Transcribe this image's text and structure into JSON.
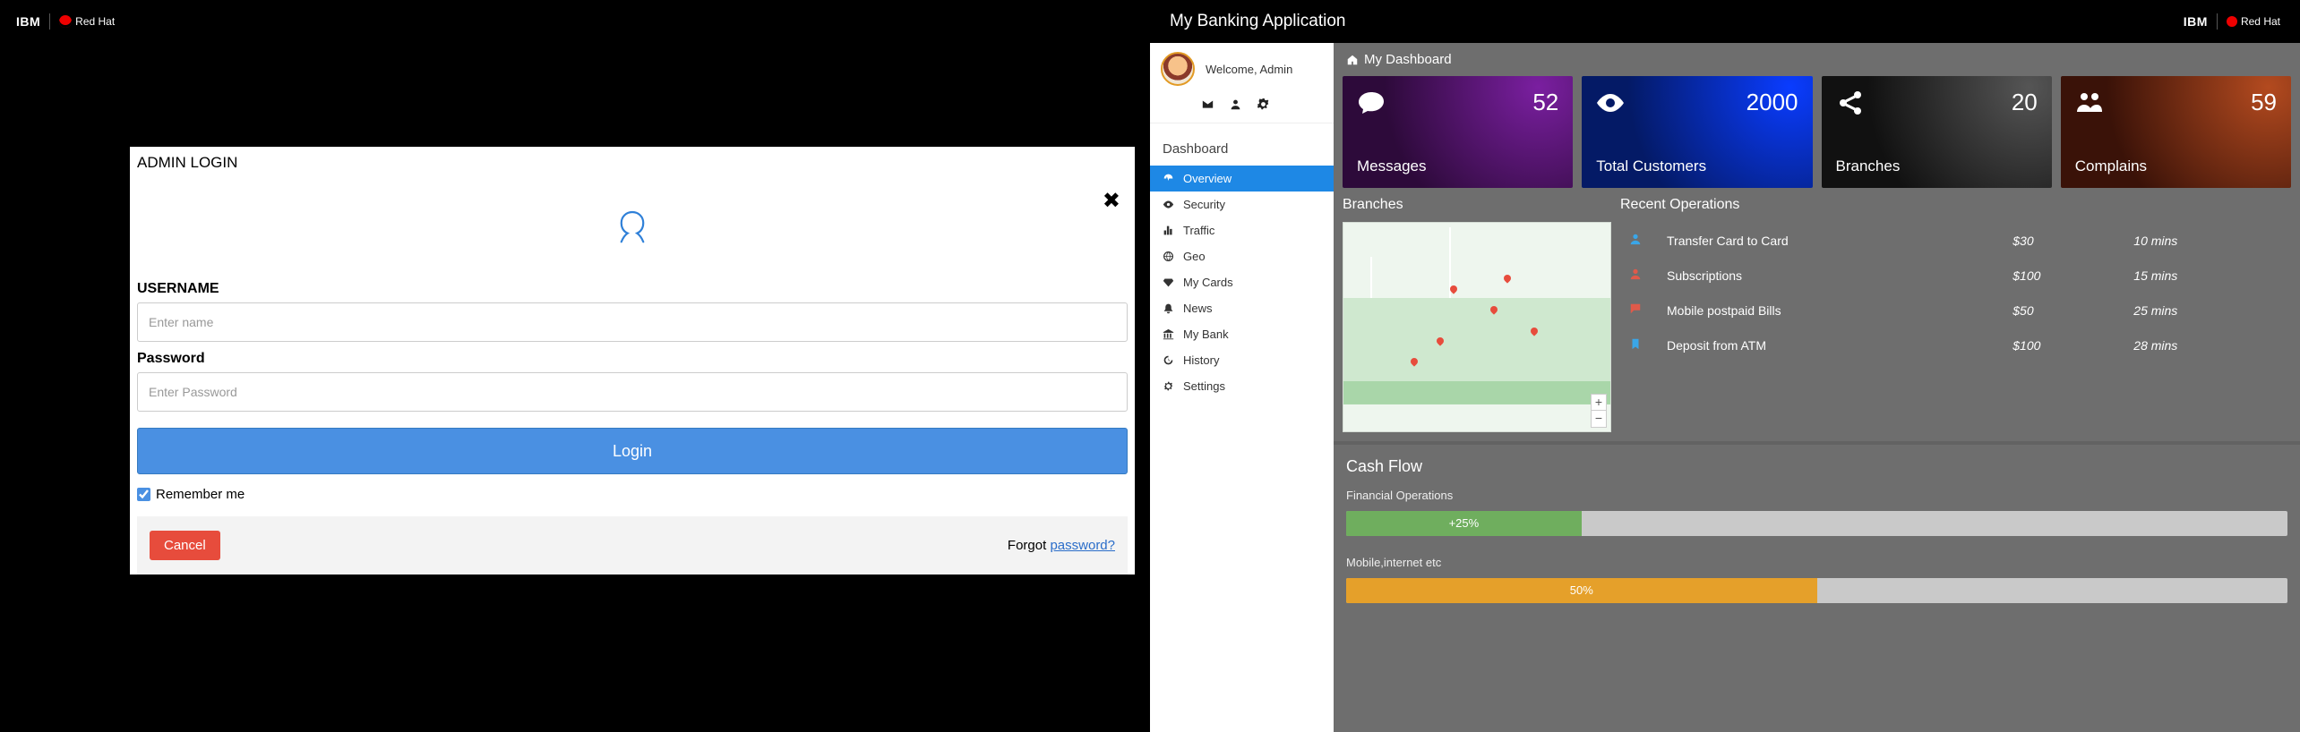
{
  "login": {
    "title": "ADMIN LOGIN",
    "username_label": "USERNAME",
    "username_placeholder": "Enter name",
    "password_label": "Password",
    "password_placeholder": "Enter Password",
    "login_button": "Login",
    "remember_label": "Remember me",
    "cancel_button": "Cancel",
    "forgot_prefix": "Forgot ",
    "forgot_link": "password?"
  },
  "app": {
    "title": "My Banking Application",
    "ibm": "IBM",
    "redhat": "Red Hat"
  },
  "sidebar": {
    "welcome": "Welcome, Admin",
    "heading": "Dashboard",
    "items": [
      {
        "label": "Overview"
      },
      {
        "label": "Security"
      },
      {
        "label": "Traffic"
      },
      {
        "label": "Geo"
      },
      {
        "label": "My Cards"
      },
      {
        "label": "News"
      },
      {
        "label": "My Bank"
      },
      {
        "label": "History"
      },
      {
        "label": "Settings"
      }
    ]
  },
  "crumb": "My Dashboard",
  "stats": [
    {
      "label": "Messages",
      "value": "52"
    },
    {
      "label": "Total Customers",
      "value": "2000"
    },
    {
      "label": "Branches",
      "value": "20"
    },
    {
      "label": "Complains",
      "value": "59"
    }
  ],
  "branches_title": "Branches",
  "ops": {
    "title": "Recent Operations",
    "rows": [
      {
        "name": "Transfer Card to Card",
        "amount": "$30",
        "time": "10 mins",
        "icon": "user",
        "color": "#3aa6e8"
      },
      {
        "name": "Subscriptions",
        "amount": "$100",
        "time": "15 mins",
        "icon": "user",
        "color": "#e05a4a"
      },
      {
        "name": "Mobile postpaid Bills",
        "amount": "$50",
        "time": "25 mins",
        "icon": "comment",
        "color": "#e05a4a"
      },
      {
        "name": "Deposit from ATM",
        "amount": "$100",
        "time": "28 mins",
        "icon": "bookmark",
        "color": "#3aa6e8"
      }
    ]
  },
  "cash": {
    "title": "Cash Flow",
    "bars": [
      {
        "label": "Financial Operations",
        "text": "+25%",
        "width": "25%",
        "class": "fill-green"
      },
      {
        "label": "Mobile,internet etc",
        "text": "50%",
        "width": "50%",
        "class": "fill-orange"
      }
    ]
  }
}
